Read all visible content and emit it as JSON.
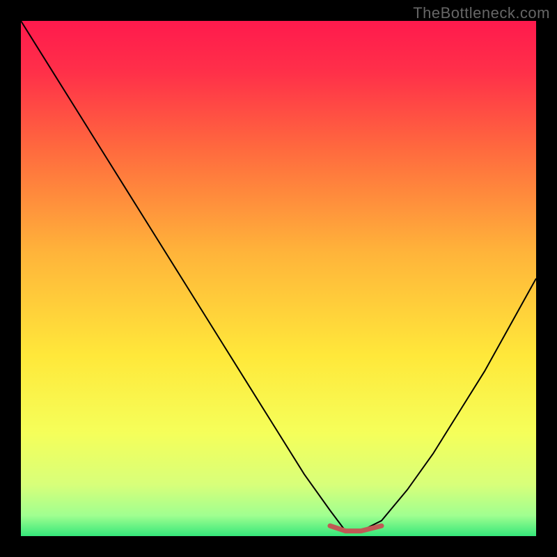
{
  "watermark": "TheBottleneck.com",
  "chart_data": {
    "type": "line",
    "title": "",
    "xlabel": "",
    "ylabel": "",
    "xlim": [
      0,
      100
    ],
    "ylim": [
      0,
      100
    ],
    "series": [
      {
        "name": "bottleneck-curve",
        "x": [
          0,
          5,
          10,
          15,
          20,
          25,
          30,
          35,
          40,
          45,
          50,
          55,
          60,
          63,
          66,
          70,
          75,
          80,
          85,
          90,
          95,
          100
        ],
        "values": [
          100,
          92,
          84,
          76,
          68,
          60,
          52,
          44,
          36,
          28,
          20,
          12,
          5,
          1,
          1,
          3,
          9,
          16,
          24,
          32,
          41,
          50
        ]
      },
      {
        "name": "optimal-zone-marker",
        "x": [
          60,
          63,
          66,
          70
        ],
        "values": [
          2,
          1,
          1,
          2
        ]
      }
    ],
    "optimal_x_range": [
      60,
      70
    ],
    "background_gradient": {
      "stops": [
        {
          "pos": 0.0,
          "color": "#ff1a4d"
        },
        {
          "pos": 0.1,
          "color": "#ff3049"
        },
        {
          "pos": 0.25,
          "color": "#ff6a3e"
        },
        {
          "pos": 0.45,
          "color": "#ffb43a"
        },
        {
          "pos": 0.65,
          "color": "#ffe83a"
        },
        {
          "pos": 0.8,
          "color": "#f5ff5a"
        },
        {
          "pos": 0.9,
          "color": "#d8ff7a"
        },
        {
          "pos": 0.96,
          "color": "#a0ff90"
        },
        {
          "pos": 1.0,
          "color": "#35e77a"
        }
      ]
    },
    "curve_color": "#000000",
    "marker_color": "#c05a55"
  }
}
